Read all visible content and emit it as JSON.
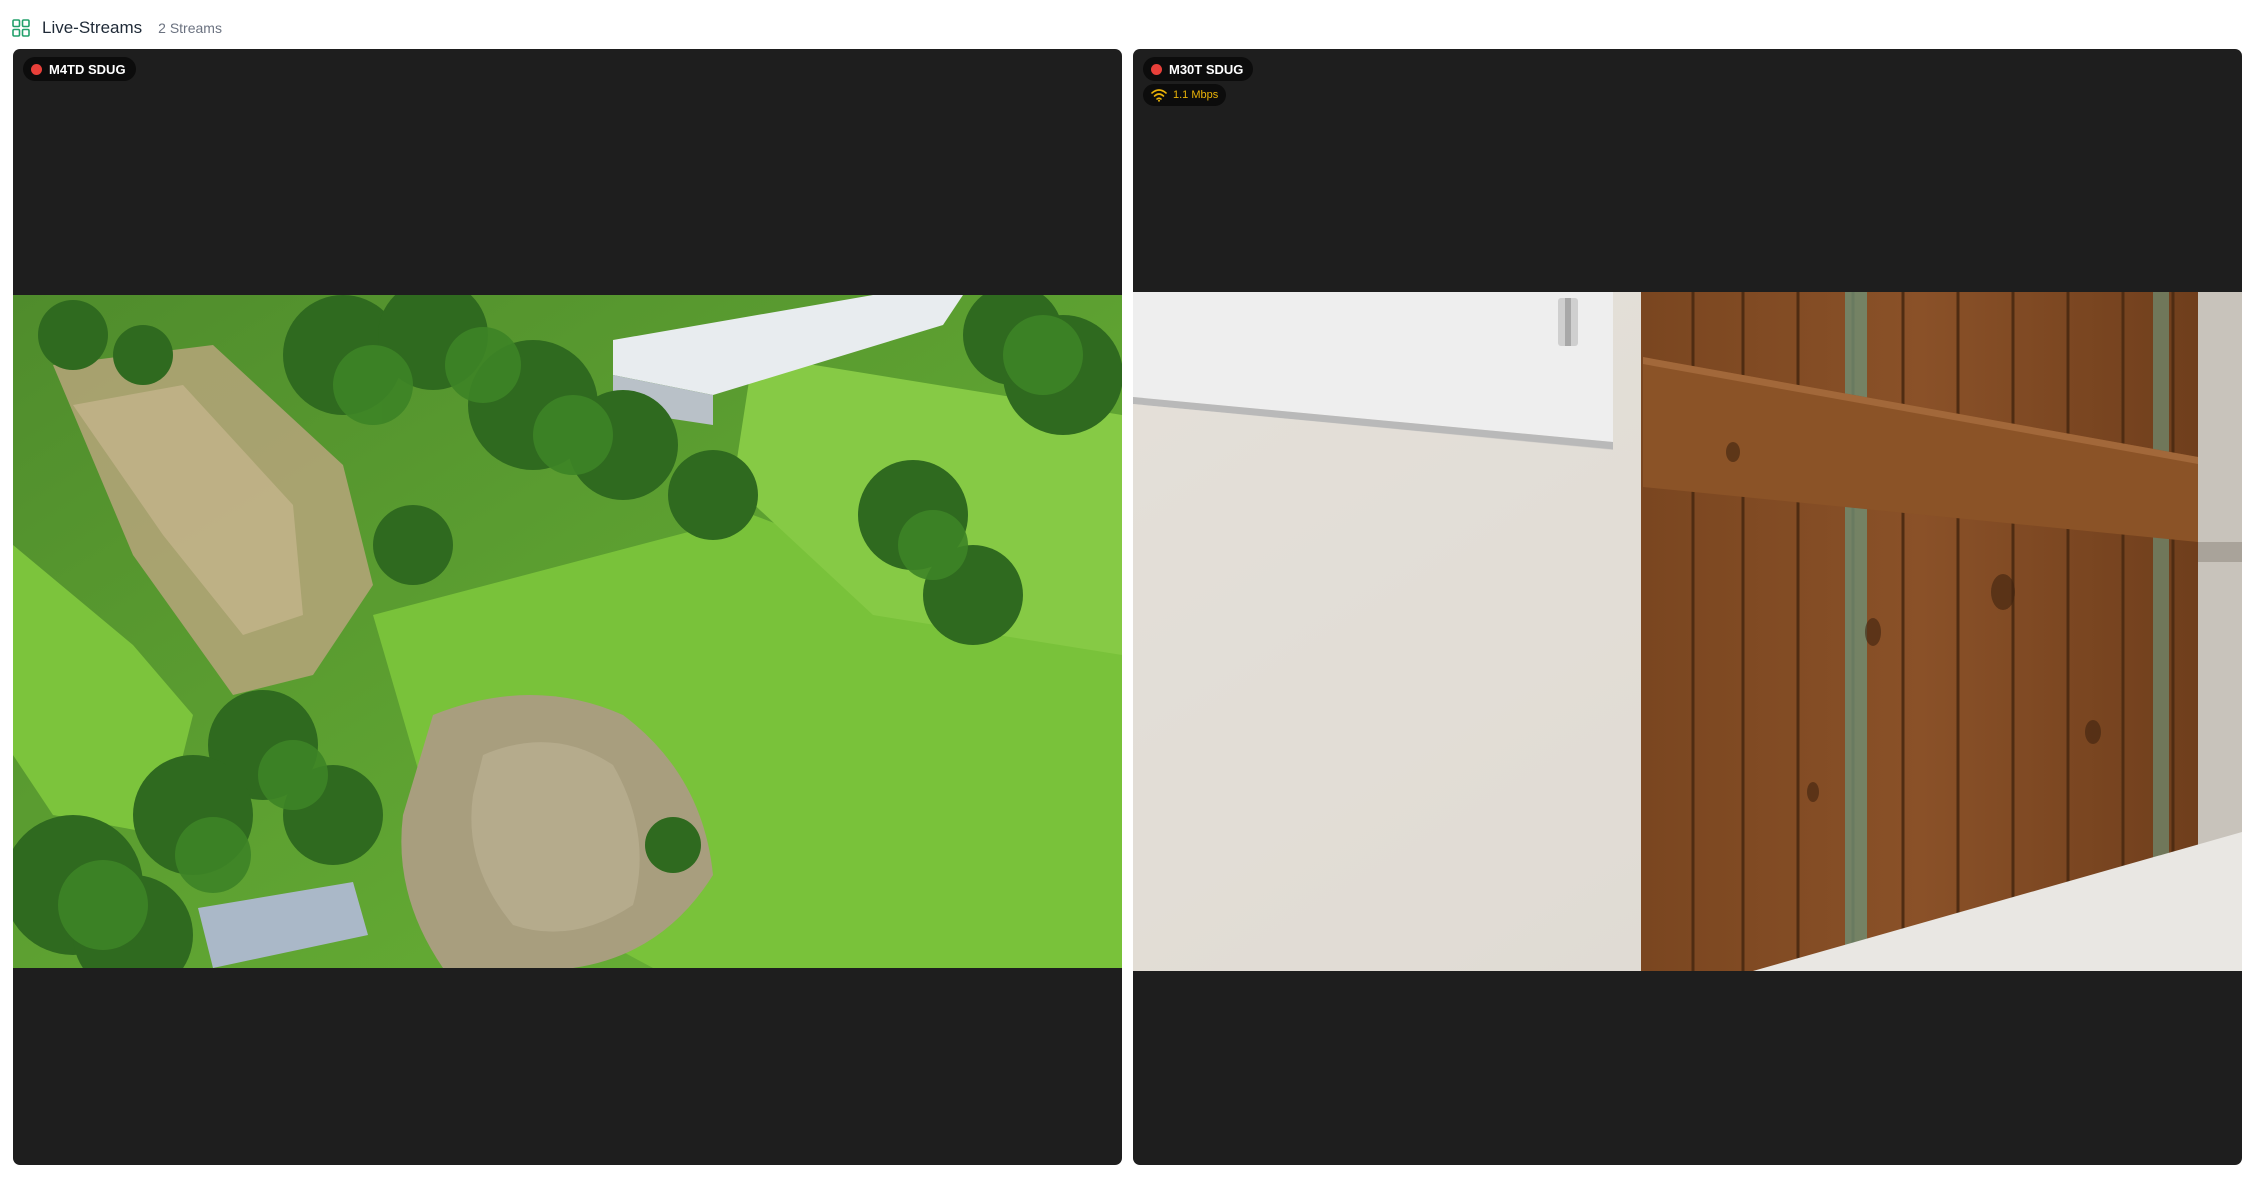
{
  "header": {
    "title": "Live-Streams",
    "count": "2 Streams",
    "icon": "grid-icon"
  },
  "streams": [
    {
      "name": "M4TD SDUG",
      "live_color": "#e8403a",
      "content": "aerial drone view of green fields and trees"
    },
    {
      "name": "M30T SDUG",
      "live_color": "#e8403a",
      "bitrate": "1.1 Mbps",
      "content": "close-up of white wall and wooden panel"
    }
  ]
}
